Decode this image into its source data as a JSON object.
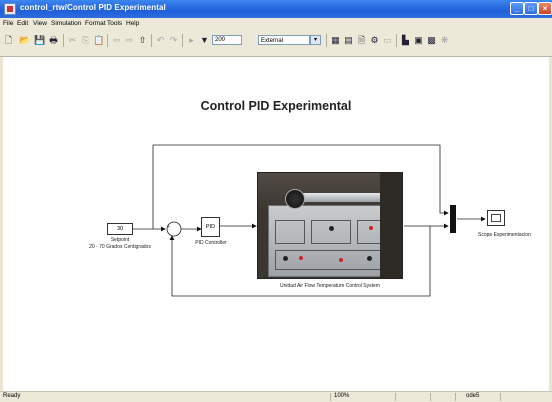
{
  "window": {
    "title": "control_rtw/Control PID Experimental"
  },
  "menu": [
    "File",
    "Edit",
    "View",
    "Simulation",
    "Format",
    "Tools",
    "Help"
  ],
  "toolbar": {
    "stop_time": "200",
    "sim_mode": "External"
  },
  "diagram": {
    "title": "Control PID Experimental",
    "setpoint_value": "30",
    "setpoint_label": "Setpoint",
    "setpoint_sublabel": "20 - 70 Grados Centigrados",
    "sum_sign": "+",
    "pid_text": "PID",
    "pid_label": "PID Controller",
    "plant_label": "Unidad Air Flow Temperature Control System",
    "scope_label": "Scope Experimentacion"
  },
  "status": {
    "left": "Ready",
    "zoom": "100%",
    "solver": "ode5"
  },
  "colors": {
    "titlebar": "#2f6ee0",
    "chrome": "#ece9d8",
    "close": "#c9432a"
  }
}
